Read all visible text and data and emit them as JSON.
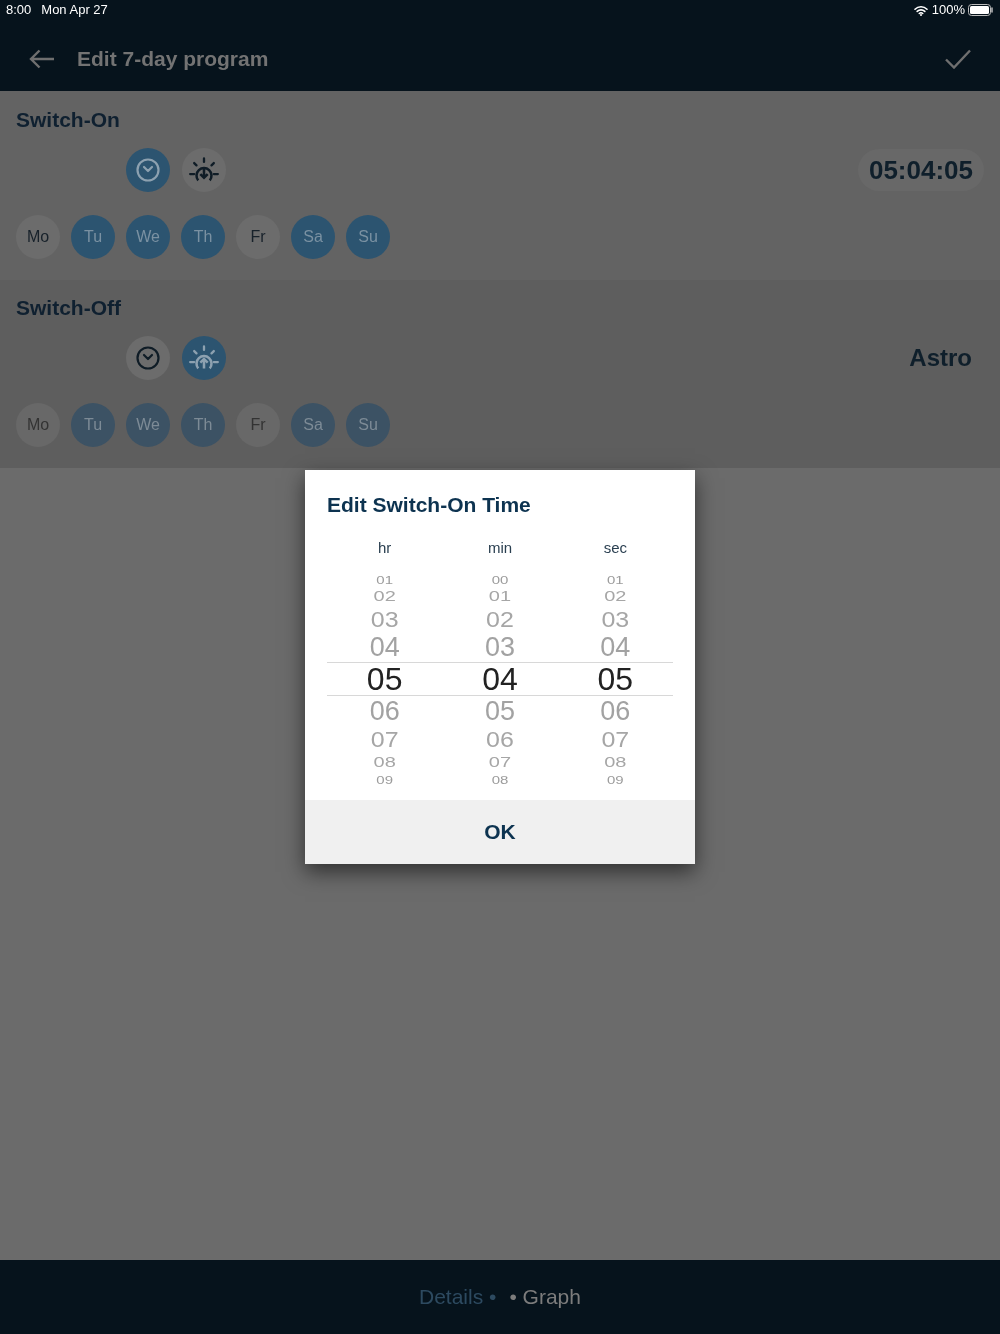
{
  "status_bar": {
    "time": "8:00",
    "date": "Mon Apr 27",
    "battery": "100%"
  },
  "header": {
    "title": "Edit 7-day program"
  },
  "sections": [
    {
      "title": "Switch-On",
      "modes": [
        {
          "kind": "clock",
          "selected": true
        },
        {
          "kind": "sunset",
          "selected": false
        }
      ],
      "value": {
        "kind": "time",
        "text": "05:04:05"
      },
      "days_disabled": false,
      "days": [
        {
          "label": "Mo",
          "selected": false
        },
        {
          "label": "Tu",
          "selected": true
        },
        {
          "label": "We",
          "selected": true
        },
        {
          "label": "Th",
          "selected": true
        },
        {
          "label": "Fr",
          "selected": false
        },
        {
          "label": "Sa",
          "selected": true
        },
        {
          "label": "Su",
          "selected": true
        }
      ]
    },
    {
      "title": "Switch-Off",
      "modes": [
        {
          "kind": "clock",
          "selected": false
        },
        {
          "kind": "sunrise",
          "selected": true
        }
      ],
      "value": {
        "kind": "label",
        "text": "Astro"
      },
      "days_disabled": true,
      "days": [
        {
          "label": "Mo",
          "selected": false
        },
        {
          "label": "Tu",
          "selected": true
        },
        {
          "label": "We",
          "selected": true
        },
        {
          "label": "Th",
          "selected": true
        },
        {
          "label": "Fr",
          "selected": false
        },
        {
          "label": "Sa",
          "selected": true
        },
        {
          "label": "Su",
          "selected": true
        }
      ]
    }
  ],
  "dialog": {
    "title": "Edit Switch-On Time",
    "columns": [
      {
        "label": "hr",
        "values": [
          {
            "text": "01",
            "selected": false
          },
          {
            "text": "02",
            "selected": false
          },
          {
            "text": "03",
            "selected": false
          },
          {
            "text": "04",
            "selected": false
          },
          {
            "text": "05",
            "selected": true
          },
          {
            "text": "06",
            "selected": false
          },
          {
            "text": "07",
            "selected": false
          },
          {
            "text": "08",
            "selected": false
          },
          {
            "text": "09",
            "selected": false
          }
        ]
      },
      {
        "label": "min",
        "values": [
          {
            "text": "00",
            "selected": false
          },
          {
            "text": "01",
            "selected": false
          },
          {
            "text": "02",
            "selected": false
          },
          {
            "text": "03",
            "selected": false
          },
          {
            "text": "04",
            "selected": true
          },
          {
            "text": "05",
            "selected": false
          },
          {
            "text": "06",
            "selected": false
          },
          {
            "text": "07",
            "selected": false
          },
          {
            "text": "08",
            "selected": false
          }
        ]
      },
      {
        "label": "sec",
        "values": [
          {
            "text": "01",
            "selected": false
          },
          {
            "text": "02",
            "selected": false
          },
          {
            "text": "03",
            "selected": false
          },
          {
            "text": "04",
            "selected": false
          },
          {
            "text": "05",
            "selected": true
          },
          {
            "text": "06",
            "selected": false
          },
          {
            "text": "07",
            "selected": false
          },
          {
            "text": "08",
            "selected": false
          },
          {
            "text": "09",
            "selected": false
          }
        ]
      }
    ],
    "button": "OK"
  },
  "bottom_tabs": [
    {
      "label": "Details •",
      "selected": true
    },
    {
      "label": "• Graph",
      "selected": false
    }
  ]
}
